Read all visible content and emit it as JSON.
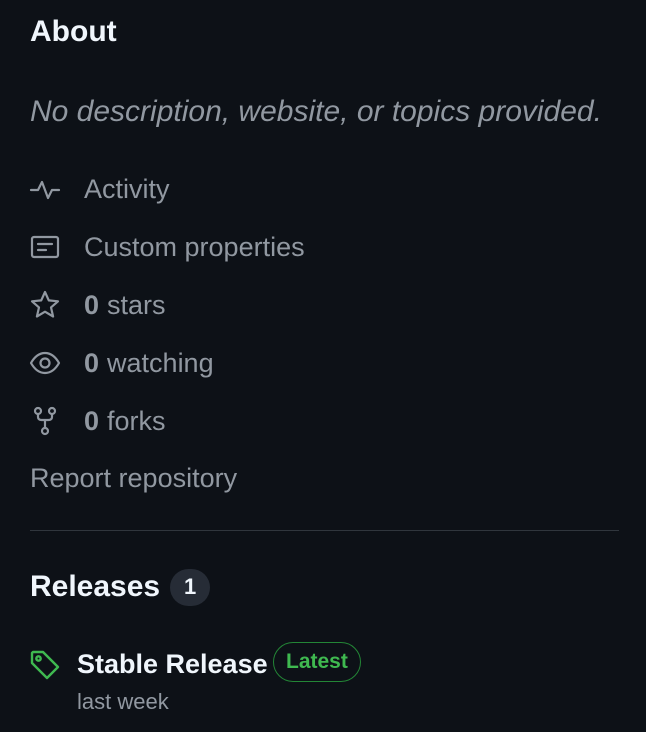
{
  "about": {
    "title": "About",
    "description": "No description, website, or topics provided."
  },
  "meta": {
    "activity": {
      "icon": "pulse-icon",
      "label": "Activity"
    },
    "custom_properties": {
      "icon": "note-icon",
      "label": "Custom properties"
    },
    "stars": {
      "icon": "star-icon",
      "count": "0",
      "label": "stars"
    },
    "watching": {
      "icon": "eye-icon",
      "count": "0",
      "label": "watching"
    },
    "forks": {
      "icon": "repo-forked-icon",
      "count": "0",
      "label": "forks"
    }
  },
  "report": {
    "label": "Report repository"
  },
  "releases": {
    "title": "Releases",
    "count": "1",
    "latest": {
      "icon": "tag-icon",
      "name": "Stable Release",
      "badge": "Latest",
      "date": "last week"
    }
  },
  "colors": {
    "background": "#0d1117",
    "heading": "#f0f6fc",
    "muted": "#9198a1",
    "divider": "#30363d",
    "badge_bg": "#262c36",
    "success": "#3fb950",
    "success_border": "#238636"
  }
}
